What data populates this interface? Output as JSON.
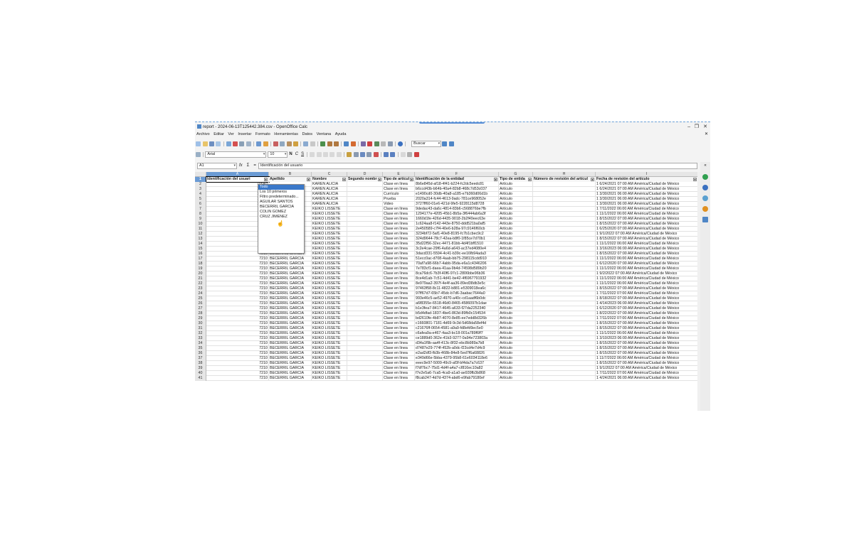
{
  "window": {
    "title": "report - 2024-06-13T125442.384.csv - OpenOffice Calc",
    "controls": [
      "–",
      "❐",
      "✕"
    ],
    "close_doc": "✕"
  },
  "menu": [
    "Archivo",
    "Editar",
    "Ver",
    "Insertar",
    "Formato",
    "Herramientas",
    "Datos",
    "Ventana",
    "Ayuda"
  ],
  "toolbar": {
    "search_placeholder": "Buscar"
  },
  "format_toolbar": {
    "font": "Arial",
    "size": "10",
    "bold": "N",
    "italic": "C",
    "underline": "S"
  },
  "formula_bar": {
    "cell_ref": "A1",
    "fx": "fx",
    "sigma": "Σ",
    "equals": "=",
    "content": "Identificación del usuario"
  },
  "columns": [
    "A",
    "B",
    "C",
    "D",
    "E",
    "F",
    "G",
    "H",
    "I"
  ],
  "headers": [
    "Identificación del usuari",
    "Apellido",
    "Nombre",
    "Segundo nombr",
    "Tipo de artícul",
    "Identificación de la entidad",
    "Tipo de entida",
    "Número de revisión del artícul",
    "Fecha de revisión del artículo"
  ],
  "rows": [
    [
      "10043",
      "",
      "KAREN ALICIA",
      "",
      "Clase en línea",
      "8b6e845d-af18-4f41-b224-fc2dc5eedc81",
      "Artículo",
      "",
      "1 6/24/2021 07:00 AM América/Ciudad de México"
    ],
    [
      "10043",
      "",
      "KAREN ALICIA",
      "",
      "Clase en línea",
      "b6ccd43b-b64b-40a4-82b8-468c7d53c037",
      "Artículo",
      "",
      "1 6/24/2021 07:00 AM América/Ciudad de México"
    ],
    [
      "10043",
      "",
      "KAREN ALICIA",
      "",
      "Currículo",
      "e1490cd0-30db-40a8-a185-e7b360d06d1b",
      "Artículo",
      "",
      "1 3/30/2021 06:00 AM América/Ciudad de México"
    ],
    [
      "10043",
      "",
      "KAREN ALICIA",
      "",
      "Prueba",
      "2020a314-fc44-4613-9adc-781ce968052e",
      "Artículo",
      "",
      "1 3/30/2021 06:00 AM América/Ciudad de México"
    ],
    [
      "10043",
      "",
      "KAREN ALICIA",
      "",
      "Video",
      "3727ff60-01e6-421d-9fe5-9228115d8728",
      "Artículo",
      "",
      "1 3/30/2021 06:00 AM América/Ciudad de México"
    ],
    [
      "7210",
      "",
      "KEIKO LISSETE",
      "",
      "Clase en línea",
      "9dedac43-da6c-4814-83b6-c568876be7fb",
      "Artículo",
      "",
      "1 7/11/2022 06:00 AM América/Ciudad de México"
    ],
    [
      "7210",
      "",
      "KEIKO LISSETE",
      "",
      "Clase en línea",
      "1294177e-4205-45b1-8b5a-3f6444ab6a3f",
      "Artículo",
      "",
      "1 11/1/2022 06:00 AM América/Ciudad de México"
    ],
    [
      "7210",
      "",
      "KEIKO LISSETE",
      "",
      "Clase en línea",
      "1660d1fe-426d-4435-9018-2b2f49eec63e",
      "Artículo",
      "",
      "1 8/15/2022 07:00 AM América/Ciudad de México"
    ],
    [
      "7210",
      "",
      "KEIKO LISSETE",
      "",
      "Clase en línea",
      "1c624aa8-f142-443e-8750-ddd521ba0af5",
      "Artículo",
      "",
      "1 8/15/2022 07:00 AM América/Ciudad de México"
    ],
    [
      "7210",
      "",
      "KEIKO LISSETE",
      "",
      "Clase en línea",
      "2e450589-c7f4-40e6-b28a-97c9146f60cb",
      "Artículo",
      "",
      "1 6/25/2020 07:00 AM América/Ciudad de México"
    ],
    [
      "7210",
      "",
      "KEIKO LISSETE",
      "",
      "Clase en línea",
      "3234bf72-5af1-40e8-8195-fc7b1cbec9c2",
      "Artículo",
      "",
      "1 9/1/2022 07:00 AM América/Ciudad de México"
    ],
    [
      "7210",
      "BECERRIL GARCIA",
      "KEIKO LISSETE",
      "",
      "Clase en línea",
      "324d9644-78c7-42ea-b8f0-1f85ce7d70b1",
      "Artículo",
      "",
      "1 8/15/2022 07:00 AM América/Ciudad de México"
    ],
    [
      "7210",
      "BECERRIL GARCIA",
      "KEIKO LISSETE",
      "",
      "Clase en línea",
      "35d22f56-32ec-4471-81bb-4d4f1bff1510",
      "Artículo",
      "",
      "1 11/1/2022 06:00 AM América/Ciudad de México"
    ],
    [
      "7210",
      "BECERRIL GARCIA",
      "KEIKO LISSETE",
      "",
      "Clase en línea",
      "3c2e4cae-29f6-4a6d-a643-ac37ed4080e4",
      "Artículo",
      "",
      "1 3/16/2023 06:00 AM América/Ciudad de México"
    ],
    [
      "7210",
      "BECERRIL GARCIA",
      "KEIKO LISSETE",
      "",
      "Clase en línea",
      "3dacd331-5594-4c41-b39c-ee16fb94ada3",
      "Artículo",
      "",
      "1 8/15/2022 07:00 AM América/Ciudad de México"
    ],
    [
      "7210",
      "BECERRIL GARCIA",
      "KEIKO LISSETE",
      "",
      "Clase en línea",
      "51ecc0ac-d708-4aab-bb75-298115cdd910",
      "Artículo",
      "",
      "1 11/1/2022 06:00 AM América/Ciudad de México"
    ],
    [
      "7210",
      "BECERRIL GARCIA",
      "KEIKO LISSETE",
      "",
      "Clase en línea",
      "70af7a98-66b7-4abb-95da-e6a1c4346206",
      "Artículo",
      "",
      "1 6/12/2020 07:00 AM América/Ciudad de México"
    ],
    [
      "7210",
      "BECERRIL GARCIA",
      "KEIKO LISSETE",
      "",
      "Clase en línea",
      "7e783cf1-daea-41aa-9b4d-74598d589b20",
      "Artículo",
      "",
      "1 11/1/2022 06:00 AM América/Ciudad de México"
    ],
    [
      "7210",
      "BECERRIL GARCIA",
      "KEIKO LISSETE",
      "",
      "Clase en línea",
      "8ca76dc6-7b3f-40f6-97c1-2806bbe96b36",
      "Artículo",
      "",
      "1 9/2/2022 07:00 AM América/Ciudad de México"
    ],
    [
      "7210",
      "BECERRIL GARCIA",
      "KEIKO LISSETE",
      "",
      "Clase en línea",
      "8ce4d1ab-7c51-4d41-be42-4f6967791932",
      "Artículo",
      "",
      "1 11/1/2022 06:00 AM América/Ciudad de México"
    ],
    [
      "7210",
      "BECERRIL GARCIA",
      "KEIKO LISSETE",
      "",
      "Clase en línea",
      "8e979aa2-397f-4e4f-aa36-89ed38db3e5c",
      "Artículo",
      "",
      "1 11/1/2022 06:00 AM América/Ciudad de México"
    ],
    [
      "7210",
      "BECERRIL GARCIA",
      "KEIKO LISSETE",
      "",
      "Clase en línea",
      "97463f58-8c11-4822-b881-e5309018ea6c",
      "Artículo",
      "",
      "1 8/15/2022 07:00 AM América/Ciudad de México"
    ],
    [
      "7210",
      "BECERRIL GARCIA",
      "KEIKO LISSETE",
      "",
      "Clase en línea",
      "97ff67d7-65b7-45dc-b7d6-3aabac7644a0",
      "Artículo",
      "",
      "1 7/11/2022 07:00 AM América/Ciudad de México"
    ],
    [
      "7210",
      "BECERRIL GARCIA",
      "KEIKO LISSETE",
      "",
      "Clase en línea",
      "993e46c5-ae52-4970-a40c-cd1aadf6b0dc",
      "Artículo",
      "",
      "1 8/18/2022 07:00 AM América/Ciudad de México"
    ],
    [
      "7210",
      "BECERRIL GARCIA",
      "KEIKO LISSETE",
      "",
      "Clase en línea",
      "a6f8355e-6518-46d0-8465-4586097b1dae",
      "Artículo",
      "",
      "1 4/14/2023 06:00 AM América/Ciudad de México"
    ],
    [
      "7210",
      "BECERRIL GARCIA",
      "KEIKO LISSETE",
      "",
      "Clase en línea",
      "b1e3fea7-8417-4645-a633-f27da2252340",
      "Artículo",
      "",
      "1 6/12/2020 07:00 AM América/Ciudad de México"
    ],
    [
      "7210",
      "BECERRIL GARCIA",
      "KEIKO LISSETE",
      "",
      "Clase en línea",
      "b5d4dfad-1837-4be6-863d-89fb0c154534",
      "Artículo",
      "",
      "1 8/22/2022 07:00 AM América/Ciudad de México"
    ],
    [
      "7210",
      "BECERRIL GARCIA",
      "KEIKO LISSETE",
      "",
      "Clase en línea",
      "bd2610fe-4b87-4070-8e85-ee7edd8d326b",
      "Artículo",
      "",
      "1 7/11/2022 07:00 AM América/Ciudad de México"
    ],
    [
      "7210",
      "BECERRIL GARCIA",
      "KEIKO LISSETE",
      "",
      "Clase en línea",
      "c1660801-7181-4d69-9c3d-5d68da58ef4d",
      "Artículo",
      "",
      "1 8/15/2022 07:00 AM América/Ciudad de México"
    ],
    [
      "7210",
      "BECERRIL GARCIA",
      "KEIKO LISSETE",
      "",
      "Clase en línea",
      "c21676ff-0654-4581-a9a9-fd8efd9ec5e0",
      "Artículo",
      "",
      "1 8/15/2022 07:00 AM América/Ciudad de México"
    ],
    [
      "7210",
      "BECERRIL GARCIA",
      "KEIKO LISSETE",
      "",
      "Clase en línea",
      "c6afea9a-e467-4aa3-bc18-001a789f6ff7",
      "Artículo",
      "",
      "1 11/1/2022 06:00 AM América/Ciudad de México"
    ],
    [
      "7210",
      "BECERRIL GARCIA",
      "KEIKO LISSETE",
      "",
      "Clase en línea",
      "ce1889d0-362e-41b3-9277-0a94e723803a",
      "Artículo",
      "",
      "1 3/10/2023 06:00 AM América/Ciudad de México"
    ],
    [
      "7210",
      "BECERRIL GARCIA",
      "KEIKO LISSETE",
      "",
      "Clase en línea",
      "d34a1f9b-aa4f-413c-8f32-ebc8b989a7b8",
      "Artículo",
      "",
      "1 8/15/2022 07:00 AM América/Ciudad de México"
    ],
    [
      "7210",
      "BECERRIL GARCIA",
      "KEIKO LISSETE",
      "",
      "Clase en línea",
      "d7487e29-774f-452b-a0dc-f23cd4e7d4c9",
      "Artículo",
      "",
      "1 8/15/2022 07:00 AM América/Ciudad de México"
    ],
    [
      "7210",
      "BECERRIL GARCIA",
      "KEIKO LISSETE",
      "",
      "Clase en línea",
      "e2ad2df3-fb3b-468b-84e8-5ed7f6a68826",
      "Artículo",
      "",
      "1 8/15/2022 07:00 AM América/Ciudad de México"
    ],
    [
      "7210",
      "BECERRIL GARCIA",
      "KEIKO LISSETE",
      "",
      "Clase en línea",
      "e349d66e-5bba-4379-95b8-61e6034118e6",
      "Artículo",
      "",
      "1 11/7/2022 06:00 AM América/Ciudad de México"
    ],
    [
      "7210",
      "BECERRIL GARCIA",
      "KEIKO LISSETE",
      "",
      "Clase en línea",
      "eeec9e97-5009-49c9-af3f-bf4da7a7c637",
      "Artículo",
      "",
      "1 8/15/2022 07:00 AM América/Ciudad de México"
    ],
    [
      "7210",
      "BECERRIL GARCIA",
      "KEIKO LISSETE",
      "",
      "Clase en línea",
      "f7df7bc7-75d1-4d4f-a4a7-cf816ec10a82",
      "Artículo",
      "",
      "1 9/1/2022 07:00 AM América/Ciudad de México"
    ],
    [
      "7210",
      "BECERRIL GARCIA",
      "KEIKO LISSETE",
      "",
      "Clase en línea",
      "f7e2e5a6-7ca5-4ca9-a1a0-ae939fb3b868",
      "Artículo",
      "",
      "1 7/11/2022 07:00 AM América/Ciudad de México"
    ],
    [
      "7210",
      "BECERRIL GARCIA",
      "KEIKO LISSETE",
      "",
      "Clase en línea",
      "f8cab247-4d7d-4374-abd6-e9fab79180ef",
      "Artículo",
      "",
      "1 4/24/2021 06:00 AM América/Ciudad de México"
    ]
  ],
  "row_numbers": [
    "1",
    "2",
    "3",
    "4",
    "5",
    "6",
    "7",
    "8",
    "9",
    "10",
    "11",
    "12",
    "13",
    "14",
    "15",
    "16",
    "17",
    "18",
    "19",
    "20",
    "21",
    "22",
    "23",
    "24",
    "25",
    "26",
    "27",
    "28",
    "29",
    "30",
    "31",
    "32",
    "33",
    "34",
    "35",
    "36",
    "37",
    "38",
    "39",
    "40",
    "41"
  ],
  "autofilter_menu": [
    "Todo",
    "Los 10 primeros",
    "Filtro predeterminado...",
    "AGUILAR SANTOS",
    "BECERRIL GARCIA",
    "COLIN GOMEZ",
    "CRUZ JIMENEZ"
  ],
  "autofilter_selected": "Todo"
}
